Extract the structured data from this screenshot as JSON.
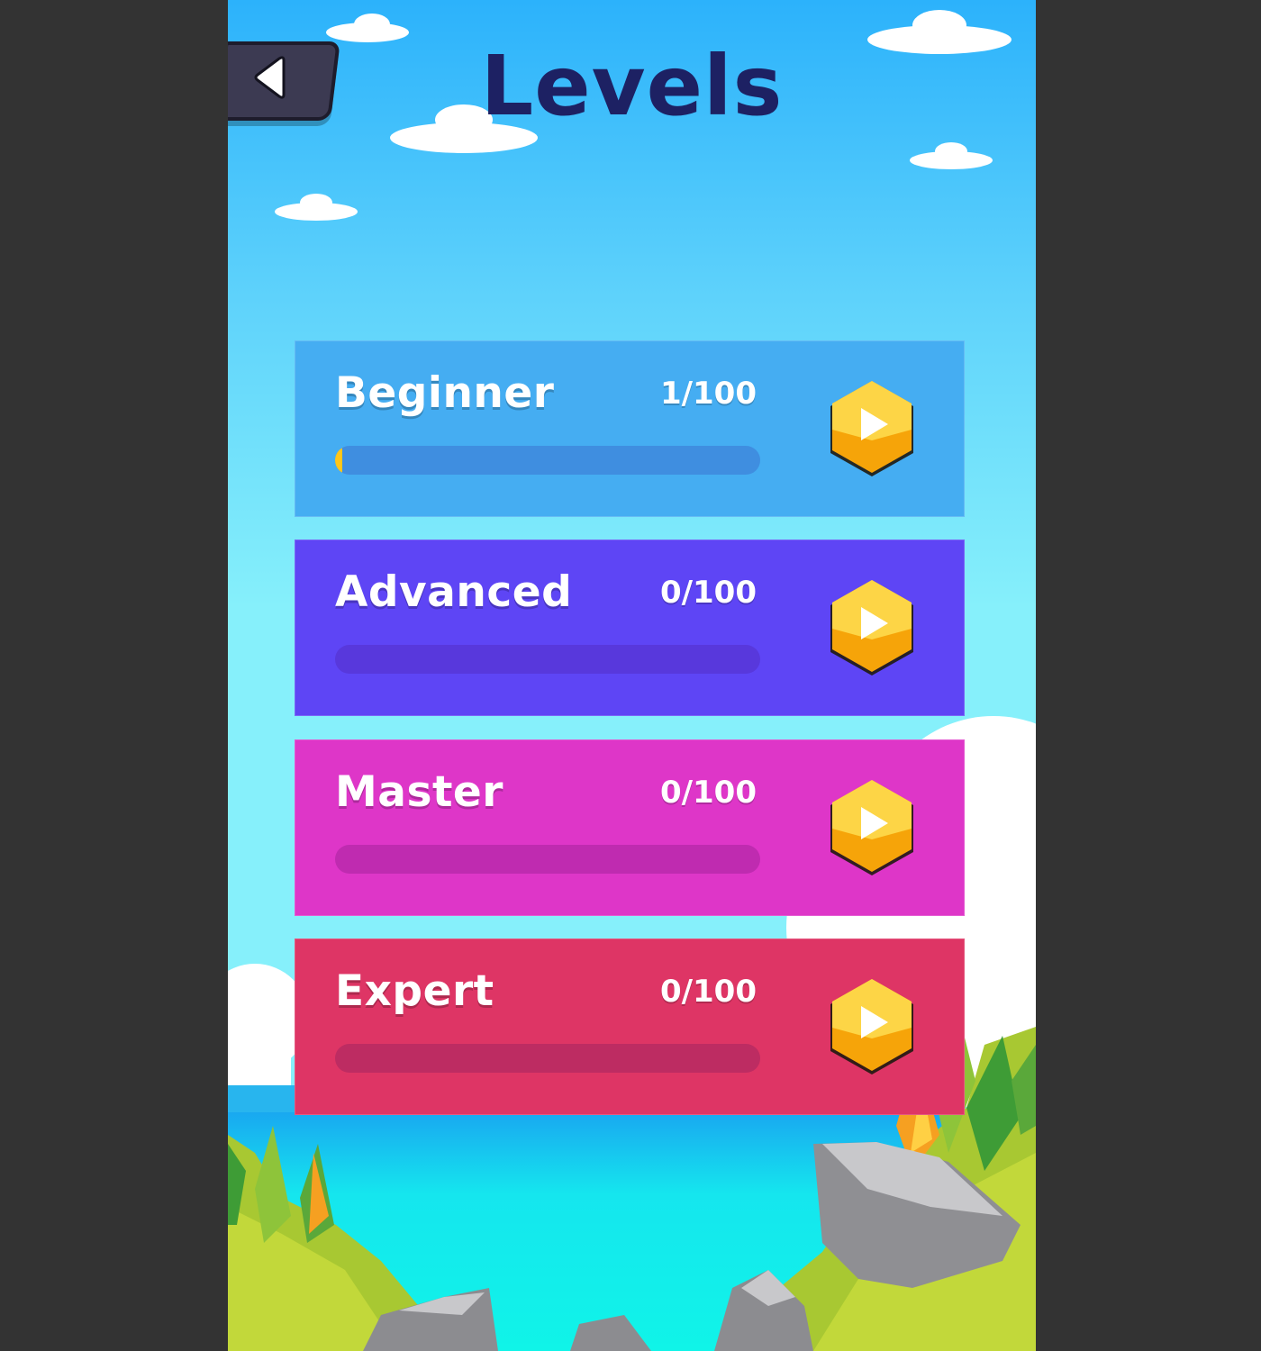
{
  "screen": {
    "title": "Levels",
    "back_button": {
      "icon": "back-arrow-icon"
    }
  },
  "levels": [
    {
      "name": "Beginner",
      "progress_text": "1/100",
      "completed": 1,
      "total": 100,
      "progress_fraction": 0.01,
      "color": "#45adf2",
      "play_icon": "play-icon"
    },
    {
      "name": "Advanced",
      "progress_text": "0/100",
      "completed": 0,
      "total": 100,
      "progress_fraction": 0,
      "color": "#5e45f5",
      "play_icon": "play-icon"
    },
    {
      "name": "Master",
      "progress_text": "0/100",
      "completed": 0,
      "total": 100,
      "progress_fraction": 0,
      "color": "#de36c8",
      "play_icon": "play-icon"
    },
    {
      "name": "Expert",
      "progress_text": "0/100",
      "completed": 0,
      "total": 100,
      "progress_fraction": 0,
      "color": "#de3565",
      "play_icon": "play-icon"
    }
  ],
  "colors": {
    "sky_top": "#2cb2fb",
    "sky_bottom": "#86f0fb",
    "title_color": "#1d2163",
    "progress_fill": "#ffc61a",
    "play_button": "#fcc21e",
    "frame_background": "#333333"
  }
}
